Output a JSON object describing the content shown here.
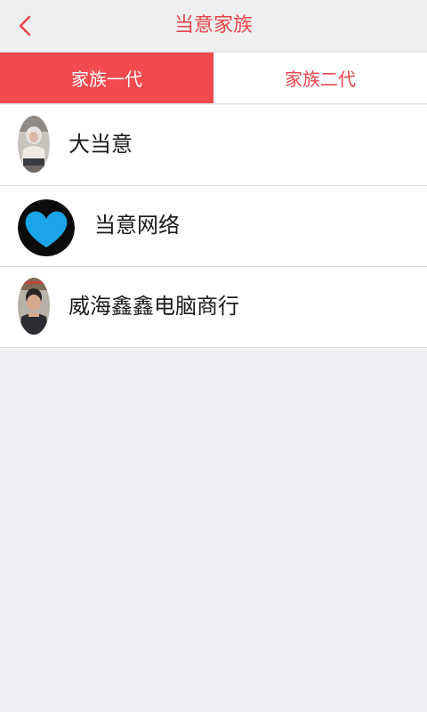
{
  "header": {
    "title": "当意家族",
    "back_icon": "chevron-left-icon"
  },
  "tabs": [
    {
      "label": "家族一代",
      "active": true
    },
    {
      "label": "家族二代",
      "active": false
    }
  ],
  "family_list": [
    {
      "name": "大当意",
      "avatar": "person-photo-avatar"
    },
    {
      "name": "当意网络",
      "avatar": "heart-logo-avatar"
    },
    {
      "name": "威海鑫鑫电脑商行",
      "avatar": "person-photo-avatar"
    }
  ],
  "colors": {
    "accent": "#f24a4f",
    "title_red": "#e8474e",
    "header_bg": "#efefef",
    "page_bg": "#f0eff4",
    "heart_blue": "#1aa5e8"
  }
}
